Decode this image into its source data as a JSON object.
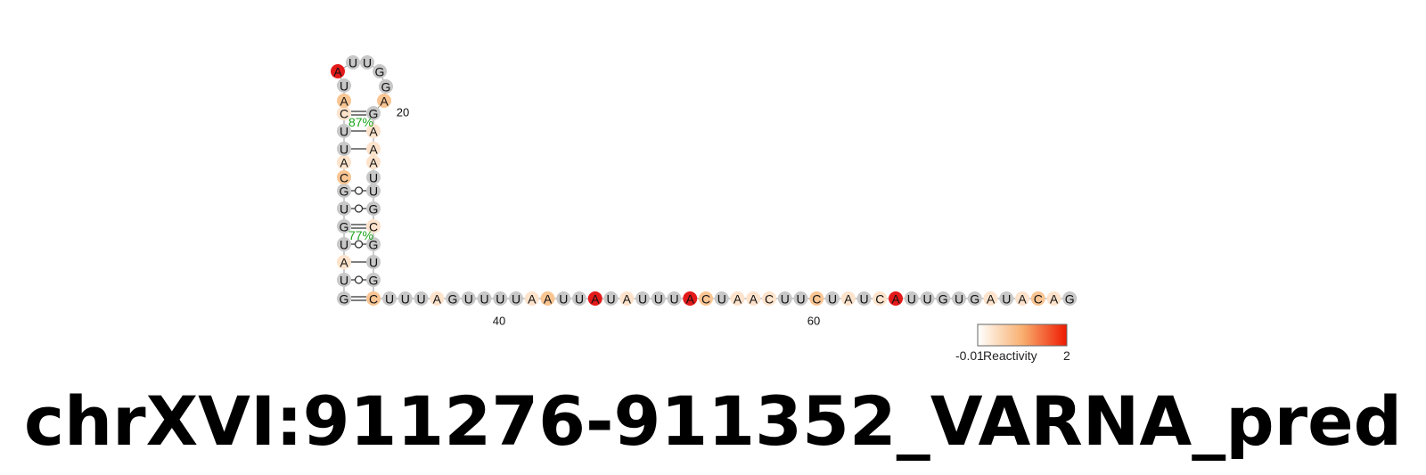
{
  "title": "chrXVI:911276-911352_VARNA_pred",
  "legend": {
    "min_label": "-0.01",
    "label": "Reactivity",
    "max_label": "2"
  },
  "position_labels": [
    "20",
    "40",
    "60"
  ],
  "probability_labels": [
    "87%",
    "77%"
  ],
  "colors": {
    "none": "#c8c8c8",
    "low": "#fde3cc",
    "mid": "#f9c593",
    "high": "#e41a1a"
  },
  "stem_left": [
    {
      "b": "G",
      "c": "none"
    },
    {
      "b": "U",
      "c": "none"
    },
    {
      "b": "A",
      "c": "low"
    },
    {
      "b": "U",
      "c": "none"
    },
    {
      "b": "G",
      "c": "none"
    },
    {
      "b": "U",
      "c": "none"
    },
    {
      "b": "G",
      "c": "none"
    },
    {
      "b": "C",
      "c": "mid"
    },
    {
      "b": "A",
      "c": "low"
    },
    {
      "b": "U",
      "c": "none"
    },
    {
      "b": "U",
      "c": "none"
    },
    {
      "b": "C",
      "c": "low"
    },
    {
      "b": "A",
      "c": "mid"
    },
    {
      "b": "U",
      "c": "none"
    }
  ],
  "loop": [
    {
      "b": "A",
      "c": "high"
    },
    {
      "b": "U",
      "c": "none"
    },
    {
      "b": "U",
      "c": "none"
    },
    {
      "b": "G",
      "c": "none"
    },
    {
      "b": "G",
      "c": "none"
    }
  ],
  "stem_right": [
    {
      "b": "A",
      "c": "mid"
    },
    {
      "b": "G",
      "c": "none"
    },
    {
      "b": "A",
      "c": "low"
    },
    {
      "b": "A",
      "c": "low"
    },
    {
      "b": "A",
      "c": "low"
    },
    {
      "b": "U",
      "c": "none"
    },
    {
      "b": "U",
      "c": "none"
    },
    {
      "b": "G",
      "c": "none"
    },
    {
      "b": "C",
      "c": "low"
    },
    {
      "b": "G",
      "c": "none"
    },
    {
      "b": "U",
      "c": "none"
    },
    {
      "b": "G",
      "c": "none"
    },
    {
      "b": "C",
      "c": "mid"
    }
  ],
  "bottom_strand": [
    {
      "b": "U",
      "c": "none"
    },
    {
      "b": "U",
      "c": "none"
    },
    {
      "b": "U",
      "c": "none"
    },
    {
      "b": "A",
      "c": "low"
    },
    {
      "b": "G",
      "c": "none"
    },
    {
      "b": "U",
      "c": "none"
    },
    {
      "b": "U",
      "c": "none"
    },
    {
      "b": "U",
      "c": "none"
    },
    {
      "b": "U",
      "c": "none"
    },
    {
      "b": "A",
      "c": "low"
    },
    {
      "b": "A",
      "c": "mid"
    },
    {
      "b": "U",
      "c": "none"
    },
    {
      "b": "U",
      "c": "none"
    },
    {
      "b": "A",
      "c": "high"
    },
    {
      "b": "U",
      "c": "none"
    },
    {
      "b": "A",
      "c": "low"
    },
    {
      "b": "U",
      "c": "none"
    },
    {
      "b": "U",
      "c": "none"
    },
    {
      "b": "U",
      "c": "none"
    },
    {
      "b": "A",
      "c": "high"
    },
    {
      "b": "C",
      "c": "mid"
    },
    {
      "b": "U",
      "c": "none"
    },
    {
      "b": "A",
      "c": "low"
    },
    {
      "b": "A",
      "c": "low"
    },
    {
      "b": "C",
      "c": "low"
    },
    {
      "b": "U",
      "c": "none"
    },
    {
      "b": "U",
      "c": "none"
    },
    {
      "b": "C",
      "c": "mid"
    },
    {
      "b": "U",
      "c": "none"
    },
    {
      "b": "A",
      "c": "low"
    },
    {
      "b": "U",
      "c": "none"
    },
    {
      "b": "C",
      "c": "low"
    },
    {
      "b": "A",
      "c": "high"
    },
    {
      "b": "U",
      "c": "none"
    },
    {
      "b": "U",
      "c": "none"
    },
    {
      "b": "G",
      "c": "none"
    },
    {
      "b": "U",
      "c": "none"
    },
    {
      "b": "G",
      "c": "none"
    },
    {
      "b": "A",
      "c": "low"
    },
    {
      "b": "U",
      "c": "none"
    },
    {
      "b": "A",
      "c": "low"
    },
    {
      "b": "C",
      "c": "mid"
    },
    {
      "b": "A",
      "c": "low"
    },
    {
      "b": "G",
      "c": "none"
    }
  ],
  "pairs": [
    {
      "type": "wc-gc"
    },
    {
      "type": "gu"
    },
    {
      "type": "wc-au"
    },
    {
      "type": "gu"
    },
    {
      "type": "wc-gc"
    },
    {
      "type": "gu"
    },
    {
      "type": "gu"
    },
    {
      "type": "wc-au"
    },
    {
      "type": "wc-au"
    },
    {
      "type": "wc-gc"
    }
  ]
}
